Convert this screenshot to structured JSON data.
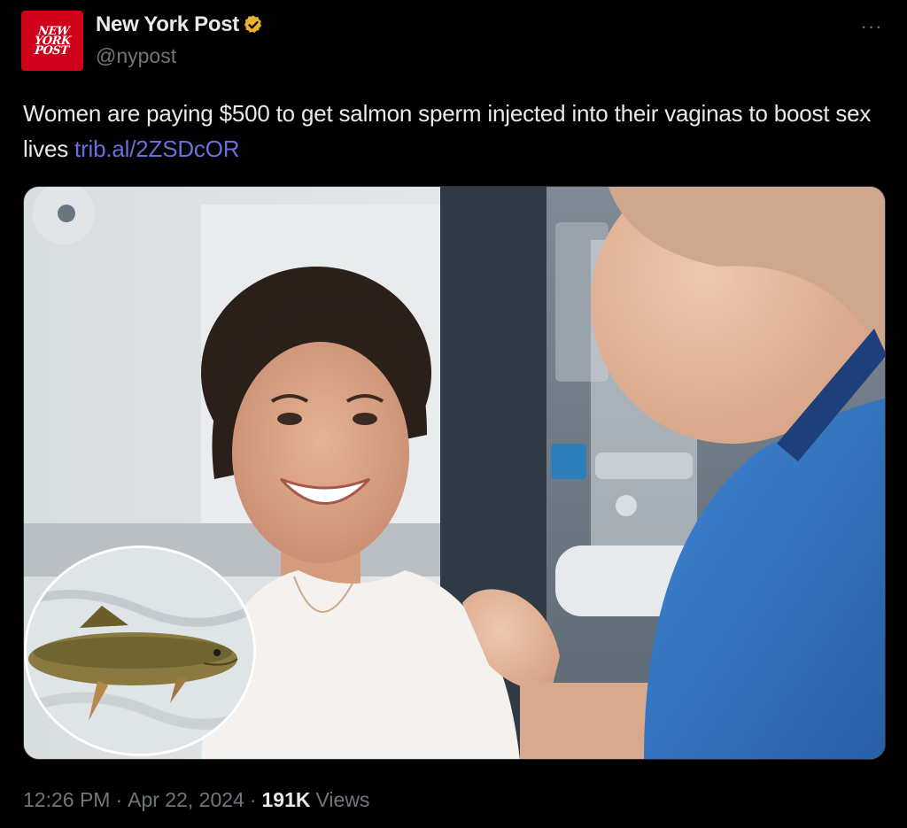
{
  "author": {
    "avatar_logo_text": "NEW\nYORK\nPOST",
    "name": "New York Post",
    "handle": "@nypost",
    "verified_icon": "verified-badge-gold",
    "brand_color": "#d0021b"
  },
  "more_menu": {
    "icon": "more-horizontal-icon",
    "label": "···"
  },
  "tweet": {
    "text": "Women are paying $500 to get salmon sperm injected into their vaginas to boost sex lives ",
    "link_text": "trib.al/2ZSDcOR",
    "link_color": "#6b6fd8"
  },
  "media": {
    "image_subject": "smiling woman patient with doctor in blue scrubs; inset circle of a salmon",
    "inset_subject": "salmon"
  },
  "footer": {
    "time": "12:26 PM",
    "separator": "·",
    "date": "Apr 22, 2024",
    "views_count": "191K",
    "views_label": "Views"
  }
}
